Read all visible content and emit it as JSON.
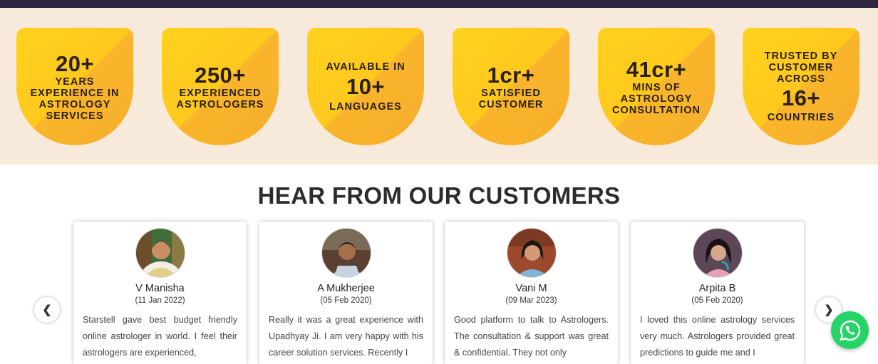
{
  "stats": [
    {
      "pre": "",
      "num": "20+",
      "label": "YEARS EXPERIENCE IN ASTROLOGY SERVICES"
    },
    {
      "pre": "",
      "num": "250+",
      "label": "EXPERIENCED ASTROLOGERS"
    },
    {
      "pre": "AVAILABLE IN",
      "num": "10+",
      "label": "LANGUAGES"
    },
    {
      "pre": "",
      "num": "1cr+",
      "label": "SATISFIED CUSTOMER"
    },
    {
      "pre": "",
      "num": "41cr+",
      "label": "MINS OF ASTROLOGY CONSULTATION"
    },
    {
      "pre": "TRUSTED BY CUSTOMER ACROSS",
      "num": "16+",
      "label": "COUNTRIES"
    }
  ],
  "section_title": "HEAR FROM OUR CUSTOMERS",
  "testimonials": [
    {
      "name": "V Manisha",
      "date": "(11 Jan 2022)",
      "text": "Starstell gave best budget friendly online astrologer in world. I feel their astrologers are experienced,"
    },
    {
      "name": "A Mukherjee",
      "date": "(05 Feb 2020)",
      "text": "Really it was a great experience with Upadhyay Ji. I am very happy with his career solution services. Recently I"
    },
    {
      "name": "Vani M",
      "date": "(09 Mar 2023)",
      "text": "Good platform to talk to Astrologers. The consultation & support was great & confidential. They not only"
    },
    {
      "name": "Arpita B",
      "date": "(05 Feb 2020)",
      "text": "I loved this online astrology services very much. Astrologers provided great predictions to guide me and I"
    }
  ],
  "nav": {
    "prev": "❮",
    "next": "❯"
  },
  "icons": {
    "whatsapp": "whatsapp-icon"
  },
  "colors": {
    "badge_yellow": "#ffd21f",
    "badge_orange": "#f7ae2c",
    "stats_bg": "#f8eadb",
    "whatsapp": "#25d366"
  }
}
